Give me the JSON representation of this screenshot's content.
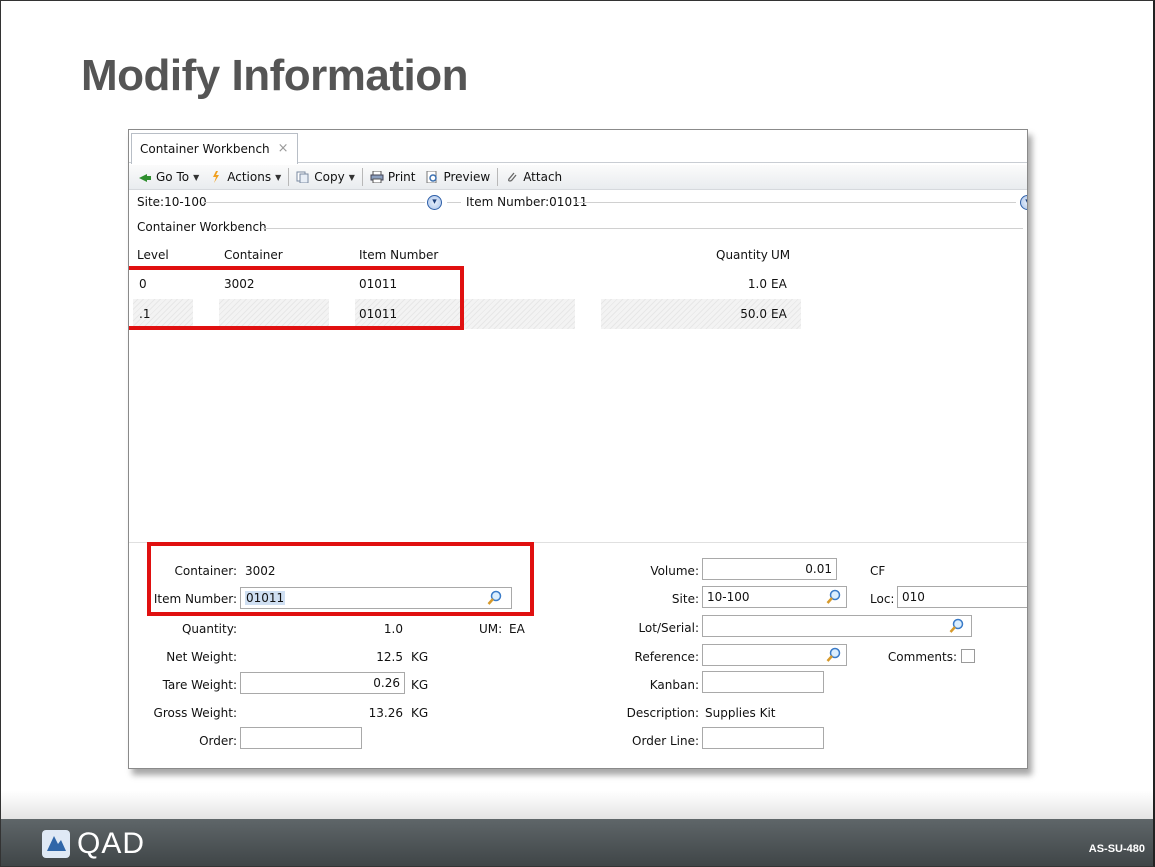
{
  "slide": {
    "title": "Modify Information",
    "logo_text": "QAD",
    "code": "AS-SU-480"
  },
  "window": {
    "tab_label": "Container Workbench",
    "tab_close": "×",
    "toolbar": {
      "goto": "Go To",
      "actions": "Actions",
      "copy": "Copy",
      "print": "Print",
      "preview": "Preview",
      "attach": "Attach"
    },
    "site_label": "Site:10-100",
    "item_label": "Item Number:01011",
    "section_label": "Container Workbench"
  },
  "grid": {
    "columns": [
      "Level",
      "Container",
      "Item Number",
      "Quantity",
      "UM"
    ],
    "rows": [
      {
        "level": "0",
        "container": "3002",
        "item": "01011",
        "quantity": "1.0",
        "um": "EA"
      },
      {
        "level": ".1",
        "container": "",
        "item": "01011",
        "quantity": "50.0",
        "um": "EA"
      }
    ]
  },
  "form": {
    "container_label": "Container:",
    "container_value": "3002",
    "item_number_label": "Item Number:",
    "item_number_value": "01011",
    "quantity_label": "Quantity:",
    "quantity_value": "1.0",
    "um_label": "UM:",
    "um_value": "EA",
    "net_weight_label": "Net Weight:",
    "net_weight_value": "12.5",
    "net_weight_unit": "KG",
    "tare_weight_label": "Tare Weight:",
    "tare_weight_value": "0.26",
    "tare_weight_unit": "KG",
    "gross_weight_label": "Gross Weight:",
    "gross_weight_value": "13.26",
    "gross_weight_unit": "KG",
    "order_label": "Order:",
    "order_value": "",
    "volume_label": "Volume:",
    "volume_value": "0.01",
    "volume_unit": "CF",
    "site_label": "Site:",
    "site_value": "10-100",
    "loc_label": "Loc:",
    "loc_value": "010",
    "lot_serial_label": "Lot/Serial:",
    "lot_serial_value": "",
    "reference_label": "Reference:",
    "reference_value": "",
    "comments_label": "Comments:",
    "kanban_label": "Kanban:",
    "kanban_value": "",
    "description_label": "Description:",
    "description_value": "Supplies Kit",
    "order_line_label": "Order Line:",
    "order_line_value": ""
  },
  "colors": {
    "highlight_box": "#e01010",
    "footer": "#4a5053"
  }
}
